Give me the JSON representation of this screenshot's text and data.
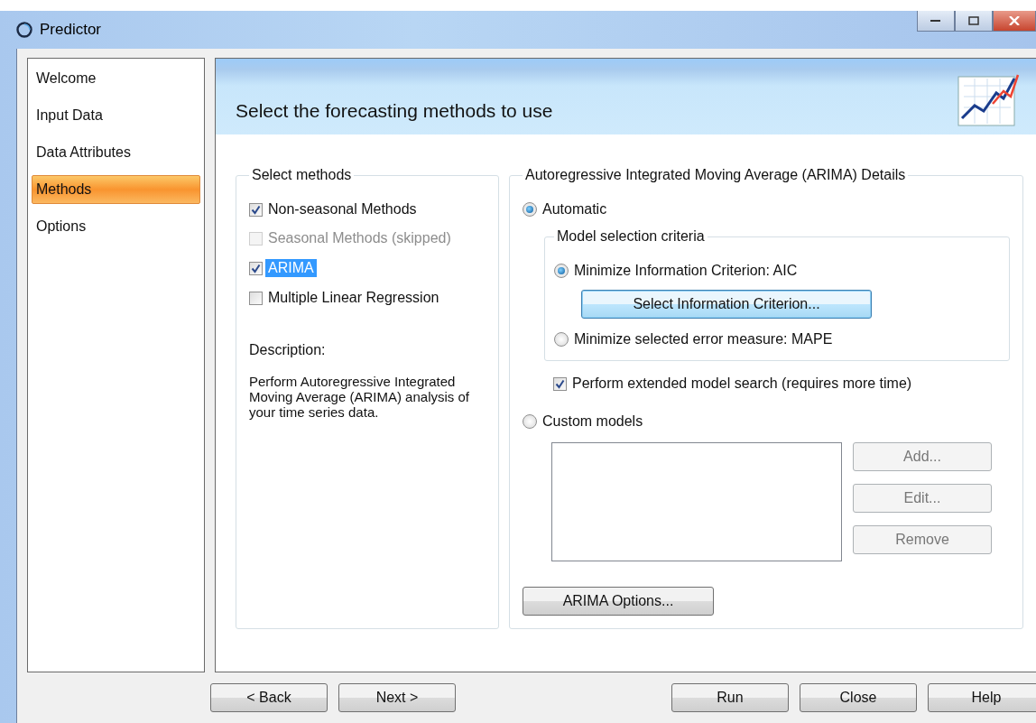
{
  "window": {
    "title": "Predictor"
  },
  "sidebar": {
    "items": [
      {
        "label": "Welcome",
        "selected": false
      },
      {
        "label": "Input Data",
        "selected": false
      },
      {
        "label": "Data Attributes",
        "selected": false
      },
      {
        "label": "Methods",
        "selected": true
      },
      {
        "label": "Options",
        "selected": false
      }
    ]
  },
  "header": {
    "title": "Select the forecasting methods to use"
  },
  "methods_group": {
    "title": "Select methods",
    "items": [
      {
        "label": "Non-seasonal Methods",
        "checked": true,
        "disabled": false,
        "selected": false
      },
      {
        "label": "Seasonal Methods (skipped)",
        "checked": false,
        "disabled": true,
        "selected": false
      },
      {
        "label": "ARIMA",
        "checked": true,
        "disabled": false,
        "selected": true
      },
      {
        "label": "Multiple Linear Regression",
        "checked": false,
        "disabled": false,
        "selected": false
      }
    ],
    "description_label": "Description:",
    "description": "Perform Autoregressive Integrated Moving Average (ARIMA) analysis of your time series data."
  },
  "arima_group": {
    "title": "Autoregressive Integrated Moving Average (ARIMA) Details",
    "automatic": {
      "label": "Automatic",
      "selected": true
    },
    "criteria_group": {
      "title": "Model selection criteria",
      "options": [
        {
          "label": "Minimize Information Criterion: AIC",
          "selected": true
        },
        {
          "label": "Minimize selected error measure: MAPE",
          "selected": false
        }
      ],
      "button": "Select Information Criterion..."
    },
    "extended_search": {
      "label": "Perform extended model search (requires more time)",
      "checked": true
    },
    "custom": {
      "label": "Custom models",
      "selected": false
    },
    "model_buttons": [
      {
        "label": "Add...",
        "disabled": true
      },
      {
        "label": "Edit...",
        "disabled": true
      },
      {
        "label": "Remove",
        "disabled": true
      }
    ],
    "options_button": "ARIMA Options..."
  },
  "footer": {
    "nav_buttons": [
      "< Back",
      "Next >"
    ],
    "buttons": [
      "Run",
      "Close",
      "Help"
    ]
  }
}
